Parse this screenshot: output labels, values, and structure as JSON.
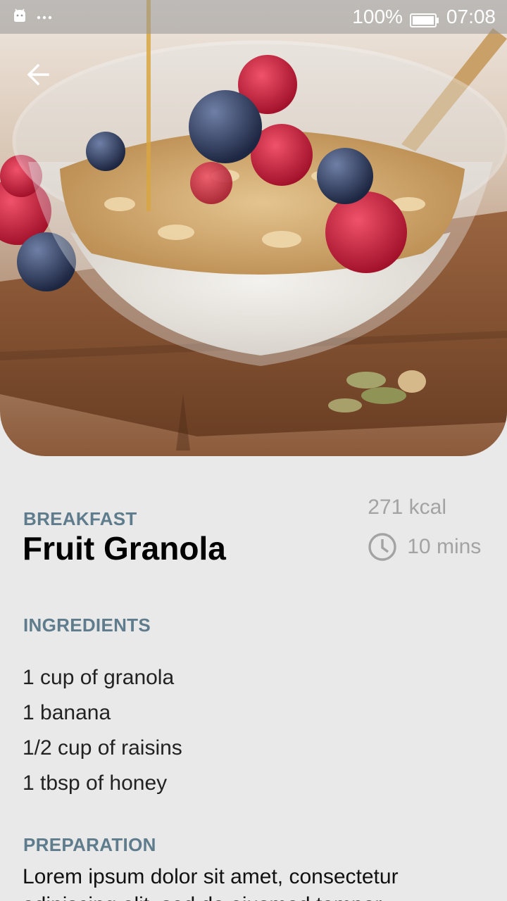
{
  "status_bar": {
    "battery": "100%",
    "time": "07:08",
    "left_icons": [
      "android-icon",
      "more-dots-icon"
    ]
  },
  "hero": {
    "image": "granola-bowl-photo"
  },
  "recipe": {
    "category": "BREAKFAST",
    "title": "Fruit Granola",
    "calories": "271 kcal",
    "duration": "10 mins"
  },
  "ingredients": {
    "heading": "INGREDIENTS",
    "items": [
      "1 cup of granola",
      "1 banana",
      "1/2 cup of raisins",
      "1 tbsp of honey"
    ]
  },
  "preparation": {
    "heading": "PREPARATION",
    "text": "Lorem ipsum dolor sit amet, consectetur adipiscing elit, sed do eiusmod tempor"
  },
  "colors": {
    "background": "#e9e9ea",
    "accent_heading": "#5f7c8d",
    "muted": "#a3a3a3"
  }
}
